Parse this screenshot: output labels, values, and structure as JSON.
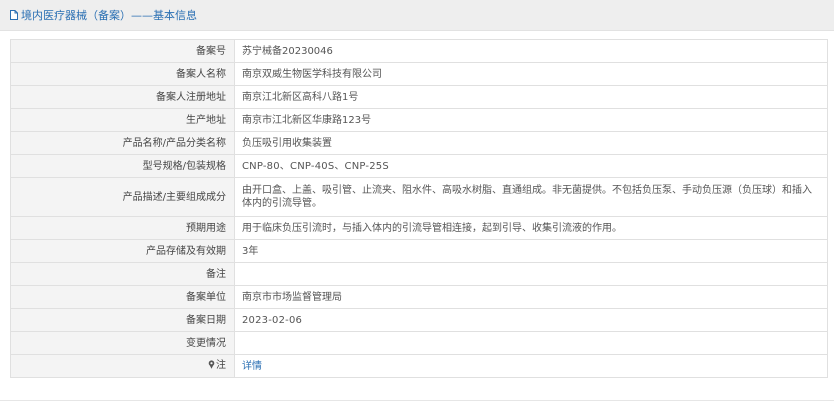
{
  "header": {
    "title": "境内医疗器械（备案）——基本信息"
  },
  "rows": [
    {
      "label": "备案号",
      "value": "苏宁械备20230046"
    },
    {
      "label": "备案人名称",
      "value": "南京双威生物医学科技有限公司"
    },
    {
      "label": "备案人注册地址",
      "value": "南京江北新区高科八路1号"
    },
    {
      "label": "生产地址",
      "value": "南京市江北新区华康路123号"
    },
    {
      "label": "产品名称/产品分类名称",
      "value": "负压吸引用收集装置"
    },
    {
      "label": "型号规格/包装规格",
      "value": "CNP-80、CNP-40S、CNP-25S"
    },
    {
      "label": "产品描述/主要组成成分",
      "value": "由开口盒、上盖、吸引管、止流夹、阻水件、高吸水树脂、直通组成。非无菌提供。不包括负压泵、手动负压源（负压球）和插入体内的引流导管。"
    },
    {
      "label": "预期用途",
      "value": "用于临床负压引流时，与插入体内的引流导管相连接，起到引导、收集引流液的作用。"
    },
    {
      "label": "产品存储及有效期",
      "value": "3年"
    },
    {
      "label": "备注",
      "value": ""
    },
    {
      "label": "备案单位",
      "value": "南京市市场监督管理局"
    },
    {
      "label": "备案日期",
      "value": "2023-02-06"
    },
    {
      "label": "变更情况",
      "value": ""
    },
    {
      "label": "注",
      "value": "详情"
    }
  ],
  "icons": {
    "title_icon": "document-icon",
    "note_icon": "pin-icon"
  },
  "colors": {
    "link": "#2a6fb3",
    "label_bg": "#f4f4f4",
    "header_bg": "#eeeeee"
  }
}
